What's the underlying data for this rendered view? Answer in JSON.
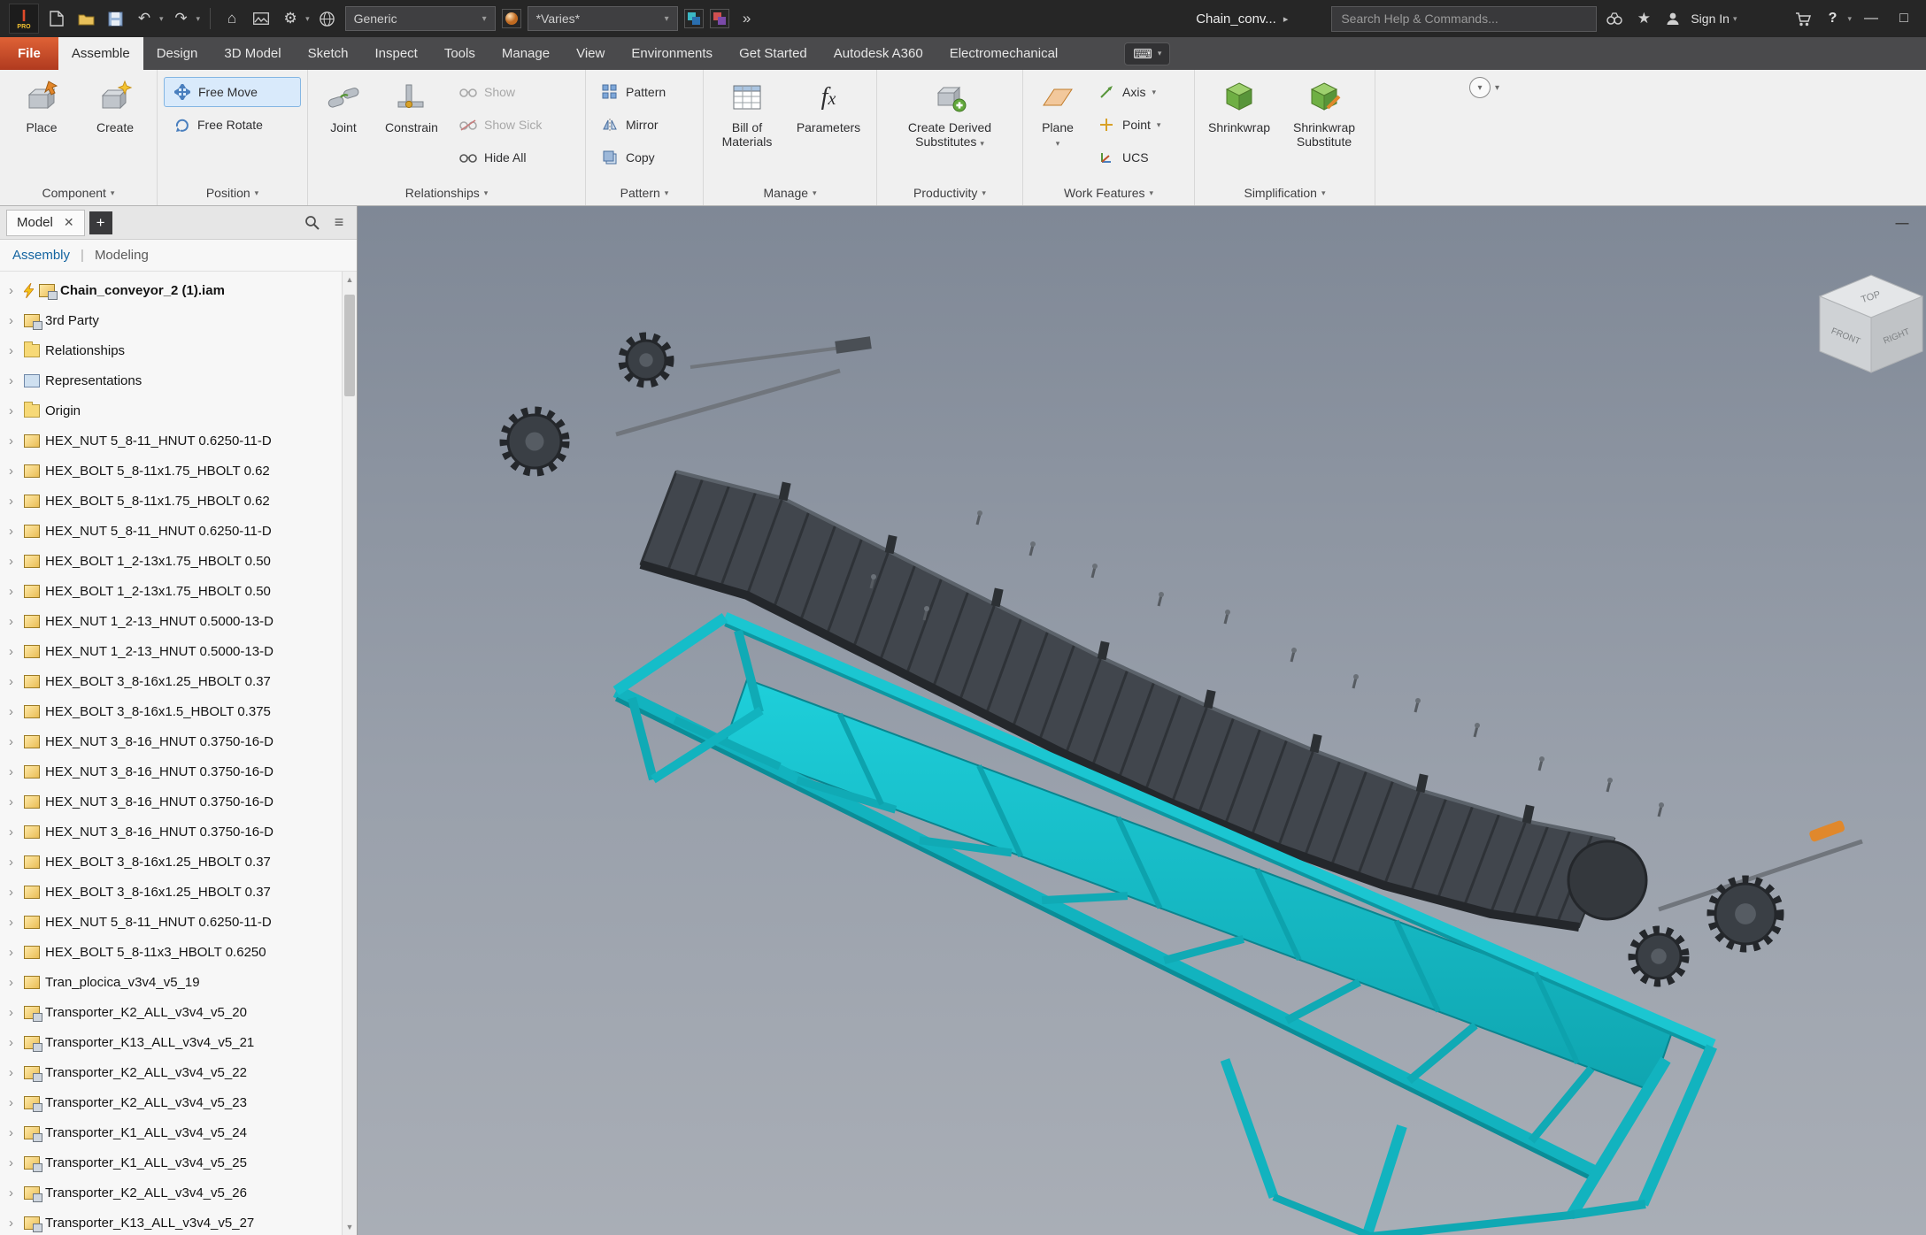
{
  "titlebar": {
    "logo_text": "I",
    "logo_sub": "PRO",
    "material_dropdown": "Generic",
    "appearance_dropdown": "*Varies*",
    "overflow": "»",
    "document_title": "Chain_conv...",
    "search_placeholder": "Search Help & Commands...",
    "sign_in_label": "Sign In",
    "help_label": "?"
  },
  "ribbon_tabs": {
    "items": [
      "File",
      "Assemble",
      "Design",
      "3D Model",
      "Sketch",
      "Inspect",
      "Tools",
      "Manage",
      "View",
      "Environments",
      "Get Started",
      "Autodesk A360",
      "Electromechanical"
    ],
    "active": "Assemble"
  },
  "ribbon": {
    "component": {
      "place": "Place",
      "create": "Create"
    },
    "position": {
      "free_move": "Free Move",
      "free_rotate": "Free Rotate"
    },
    "relationships": {
      "joint": "Joint",
      "constrain": "Constrain",
      "show": "Show",
      "show_sick": "Show Sick",
      "hide_all": "Hide All"
    },
    "pattern": {
      "pattern": "Pattern",
      "mirror": "Mirror",
      "copy": "Copy"
    },
    "manage": {
      "bom": "Bill of Materials",
      "parameters": "Parameters"
    },
    "productivity": {
      "derived": "Create Derived Substitutes"
    },
    "work_features": {
      "plane": "Plane",
      "axis": "Axis",
      "point": "Point",
      "ucs": "UCS"
    },
    "simplification": {
      "shrinkwrap": "Shrinkwrap",
      "shrinkwrap_substitute": "Shrinkwrap Substitute"
    },
    "panel_labels": [
      "Component",
      "Position",
      "Relationships",
      "Pattern",
      "Manage",
      "Productivity",
      "Work Features",
      "Simplification"
    ]
  },
  "browser": {
    "tab_label": "Model",
    "subtabs": {
      "assembly": "Assembly",
      "modeling": "Modeling"
    },
    "tree": [
      {
        "label": "Chain_conveyor_2 (1).iam",
        "icon": "assembly-root",
        "bold": true
      },
      {
        "label": "3rd Party",
        "icon": "assembly"
      },
      {
        "label": "Relationships",
        "icon": "folder"
      },
      {
        "label": "Representations",
        "icon": "representations"
      },
      {
        "label": "Origin",
        "icon": "folder"
      },
      {
        "label": "HEX_NUT 5_8-11_HNUT 0.6250-11-D",
        "icon": "part"
      },
      {
        "label": "HEX_BOLT 5_8-11x1.75_HBOLT 0.62",
        "icon": "part"
      },
      {
        "label": "HEX_BOLT 5_8-11x1.75_HBOLT 0.62",
        "icon": "part"
      },
      {
        "label": "HEX_NUT 5_8-11_HNUT 0.6250-11-D",
        "icon": "part"
      },
      {
        "label": "HEX_BOLT 1_2-13x1.75_HBOLT 0.50",
        "icon": "part"
      },
      {
        "label": "HEX_BOLT 1_2-13x1.75_HBOLT 0.50",
        "icon": "part"
      },
      {
        "label": "HEX_NUT 1_2-13_HNUT 0.5000-13-D",
        "icon": "part"
      },
      {
        "label": "HEX_NUT 1_2-13_HNUT 0.5000-13-D",
        "icon": "part"
      },
      {
        "label": "HEX_BOLT 3_8-16x1.25_HBOLT 0.37",
        "icon": "part"
      },
      {
        "label": "HEX_BOLT 3_8-16x1.5_HBOLT 0.375",
        "icon": "part"
      },
      {
        "label": "HEX_NUT 3_8-16_HNUT 0.3750-16-D",
        "icon": "part"
      },
      {
        "label": "HEX_NUT 3_8-16_HNUT 0.3750-16-D",
        "icon": "part"
      },
      {
        "label": "HEX_NUT 3_8-16_HNUT 0.3750-16-D",
        "icon": "part"
      },
      {
        "label": "HEX_NUT 3_8-16_HNUT 0.3750-16-D",
        "icon": "part"
      },
      {
        "label": "HEX_BOLT 3_8-16x1.25_HBOLT 0.37",
        "icon": "part"
      },
      {
        "label": "HEX_BOLT 3_8-16x1.25_HBOLT 0.37",
        "icon": "part"
      },
      {
        "label": "HEX_NUT 5_8-11_HNUT 0.6250-11-D",
        "icon": "part"
      },
      {
        "label": "HEX_BOLT 5_8-11x3_HBOLT 0.6250",
        "icon": "part"
      },
      {
        "label": "Tran_plocica_v3v4_v5_19",
        "icon": "part"
      },
      {
        "label": "Transporter_K2_ALL_v3v4_v5_20",
        "icon": "assembly"
      },
      {
        "label": "Transporter_K13_ALL_v3v4_v5_21",
        "icon": "assembly"
      },
      {
        "label": "Transporter_K2_ALL_v3v4_v5_22",
        "icon": "assembly"
      },
      {
        "label": "Transporter_K2_ALL_v3v4_v5_23",
        "icon": "assembly"
      },
      {
        "label": "Transporter_K1_ALL_v3v4_v5_24",
        "icon": "assembly"
      },
      {
        "label": "Transporter_K1_ALL_v3v4_v5_25",
        "icon": "assembly"
      },
      {
        "label": "Transporter_K2_ALL_v3v4_v5_26",
        "icon": "assembly"
      },
      {
        "label": "Transporter_K13_ALL_v3v4_v5_27",
        "icon": "assembly"
      }
    ]
  },
  "viewport": {
    "viewcube": {
      "top": "TOP",
      "front": "FRONT",
      "right": "RIGHT"
    },
    "model_colors": {
      "frame": "#14bfcb",
      "belt": "#41464d"
    }
  }
}
